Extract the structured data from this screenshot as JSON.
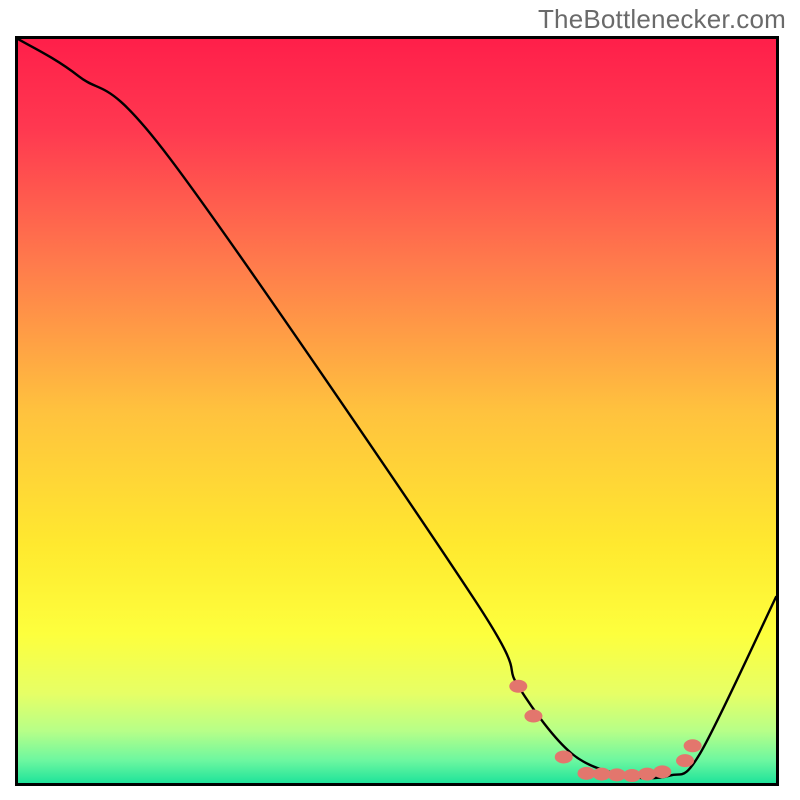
{
  "attribution": "TheBottlenecker.com",
  "chart_data": {
    "type": "line",
    "title": "",
    "xlabel": "",
    "ylabel": "",
    "xlim": [
      0,
      100
    ],
    "ylim": [
      0,
      100
    ],
    "grid": false,
    "legend": false,
    "series": [
      {
        "name": "bottleneck-curve",
        "x": [
          0,
          8,
          20,
          60,
          66,
          73,
          80,
          86,
          90,
          100
        ],
        "y": [
          100,
          95,
          84,
          25,
          13,
          4,
          1,
          1,
          4,
          25
        ]
      }
    ],
    "markers": {
      "name": "highlight-dots",
      "color": "#e3766d",
      "points": [
        {
          "x": 66,
          "y": 13
        },
        {
          "x": 68,
          "y": 9
        },
        {
          "x": 72,
          "y": 3.5
        },
        {
          "x": 75,
          "y": 1.3
        },
        {
          "x": 77,
          "y": 1.2
        },
        {
          "x": 79,
          "y": 1.1
        },
        {
          "x": 81,
          "y": 1.0
        },
        {
          "x": 83,
          "y": 1.2
        },
        {
          "x": 85,
          "y": 1.5
        },
        {
          "x": 88,
          "y": 3
        },
        {
          "x": 89,
          "y": 5
        }
      ]
    },
    "background_gradient": {
      "stops": [
        {
          "pos": 0.0,
          "color": "#ff1f4a"
        },
        {
          "pos": 0.12,
          "color": "#ff3850"
        },
        {
          "pos": 0.3,
          "color": "#ff7a4c"
        },
        {
          "pos": 0.5,
          "color": "#ffc23e"
        },
        {
          "pos": 0.68,
          "color": "#ffe92f"
        },
        {
          "pos": 0.8,
          "color": "#fdff3d"
        },
        {
          "pos": 0.88,
          "color": "#e6ff66"
        },
        {
          "pos": 0.93,
          "color": "#b7ff88"
        },
        {
          "pos": 0.97,
          "color": "#6cf7a0"
        },
        {
          "pos": 1.0,
          "color": "#1fe39a"
        }
      ]
    }
  }
}
